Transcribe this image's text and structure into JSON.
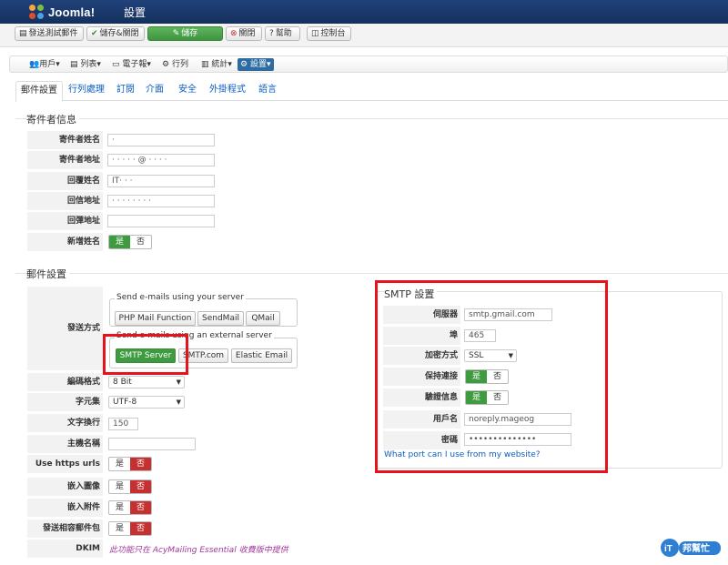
{
  "header": {
    "logo_text": "Joomla!",
    "title": "設置"
  },
  "toolbar": {
    "send_test": "發送測試郵件",
    "save_close": "儲存&關閉",
    "save": "儲存",
    "close": "關閉",
    "help": "幫助",
    "control_panel": "控制台"
  },
  "nav": {
    "users": "用戶",
    "lists": "列表",
    "newsletters": "電子報",
    "queue": "行列",
    "stats": "統計",
    "config": "設置"
  },
  "tabs": [
    "郵件設置",
    "行列處理",
    "訂閱",
    "介面",
    "安全",
    "外掛程式",
    "語言"
  ],
  "sender": {
    "legend": "寄件者信息",
    "from_name_label": "寄件者姓名",
    "from_name_value": "·",
    "from_email_label": "寄件者地址",
    "from_email_value": "· · · · ·  @ · · · ·",
    "reply_name_label": "回覆姓名",
    "reply_name_value": "IT· · ·",
    "reply_email_label": "回信地址",
    "reply_email_value": "·  · · · · · · ·",
    "bounce_label": "回彈地址",
    "bounce_value": "",
    "add_name_label": "新增姓名",
    "yes": "是",
    "no": "否"
  },
  "mail": {
    "legend": "郵件設置",
    "method_label": "發送方式",
    "own_server_title": "Send e-mails using your server",
    "php_mail": "PHP Mail Function",
    "sendmail": "SendMail",
    "qmail": "QMail",
    "external_title": "Send e-mails using an external server",
    "smtp_server": "SMTP Server",
    "smtp_com": "SMTP.com",
    "elastic": "Elastic Email",
    "encoding_label": "編碼格式",
    "encoding_value": "8 Bit",
    "charset_label": "字元集",
    "charset_value": "UTF-8",
    "wrap_label": "文字換行",
    "wrap_value": "150",
    "hostname_label": "主機名稱",
    "hostname_value": "",
    "https_label": "Use https urls",
    "embed_images_label": "嵌入圖像",
    "embed_attach_label": "嵌入附件",
    "multipart_label": "發送相容郵件包",
    "dkim_label": "DKIM",
    "dkim_text": "此功能只在 AcyMailing Essential 收費版中提供",
    "yes": "是",
    "no": "否"
  },
  "smtp": {
    "legend": "SMTP 設置",
    "server_label": "伺服器",
    "server_value": "smtp.gmail.com",
    "port_label": "埠",
    "port_value": "465",
    "secure_label": "加密方式",
    "secure_value": "SSL",
    "keepalive_label": "保持連接",
    "auth_label": "驗證信息",
    "username_label": "用戶名",
    "username_value": "noreply.mageog",
    "password_label": "密碼",
    "password_value": "••••••••••••••",
    "port_link": "What port can I use from my website?",
    "yes": "是",
    "no": "否"
  },
  "watermark": {
    "text": "iT邦幫忙"
  },
  "colors": {
    "header": "#1a3867",
    "green": "#3f9b3f",
    "red": "#c33131",
    "highlight": "#e8121b",
    "link": "#0a5ec2"
  }
}
